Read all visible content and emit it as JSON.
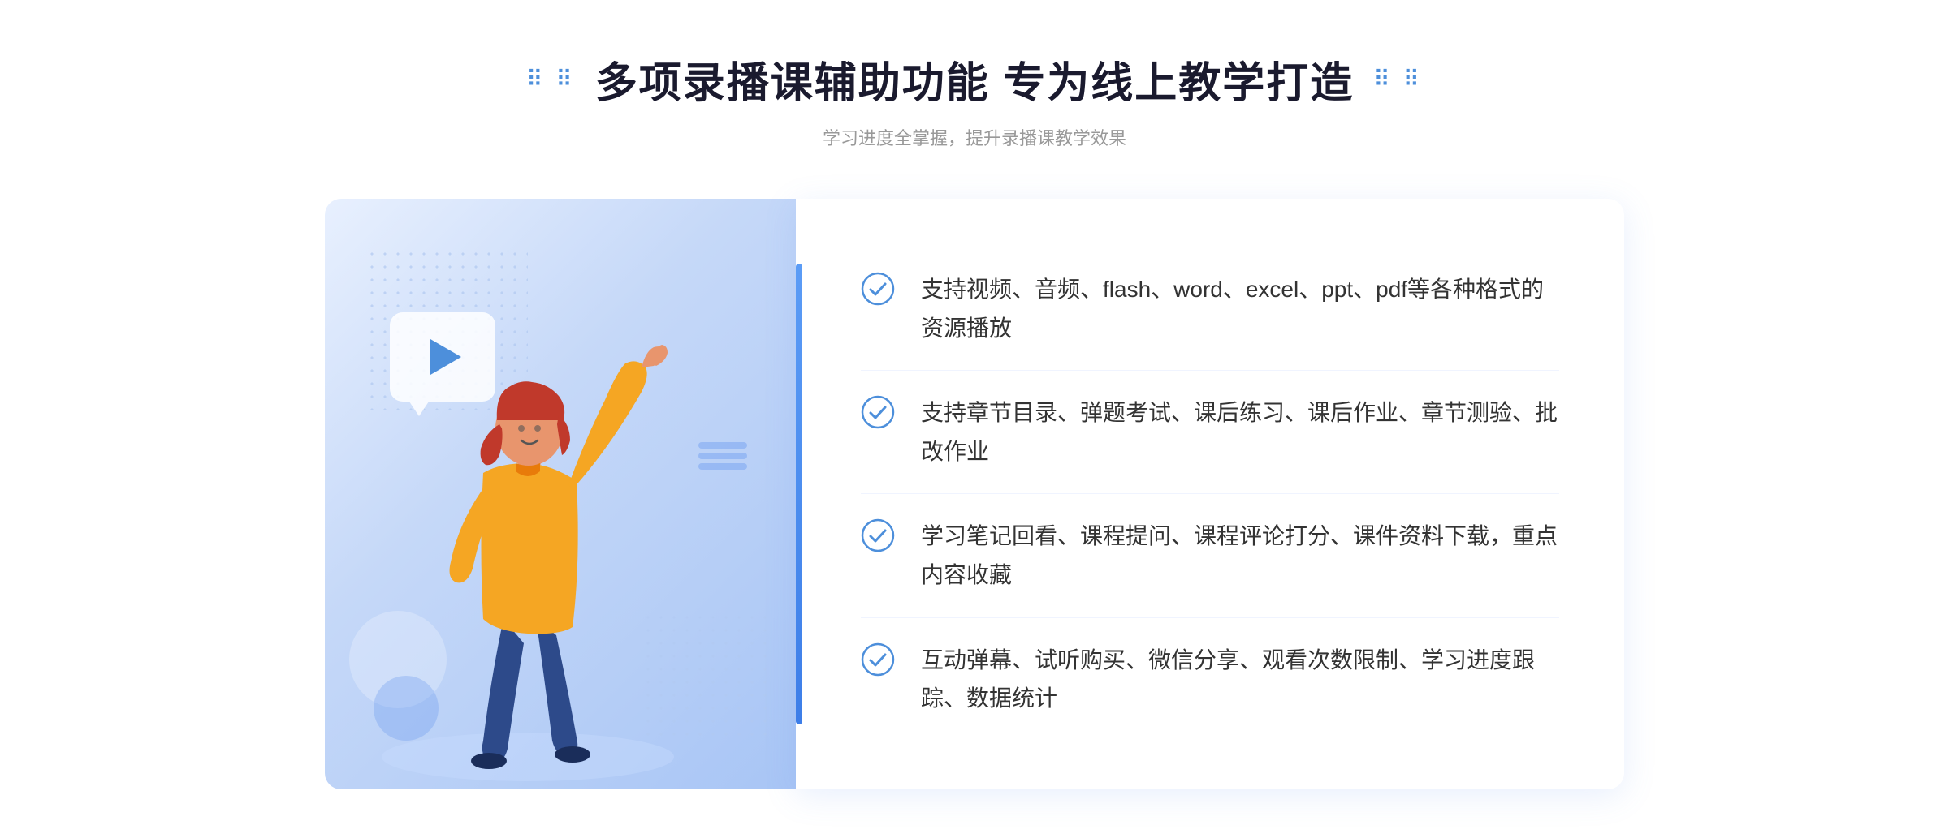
{
  "header": {
    "title": "多项录播课辅助功能 专为线上教学打造",
    "subtitle": "学习进度全掌握，提升录播课教学效果",
    "dots_left": "⠿",
    "dots_right": "⠿"
  },
  "features": [
    {
      "id": 1,
      "text": "支持视频、音频、flash、word、excel、ppt、pdf等各种格式的资源播放"
    },
    {
      "id": 2,
      "text": "支持章节目录、弹题考试、课后练习、课后作业、章节测验、批改作业"
    },
    {
      "id": 3,
      "text": "学习笔记回看、课程提问、课程评论打分、课件资料下载，重点内容收藏"
    },
    {
      "id": 4,
      "text": "互动弹幕、试听购买、微信分享、观看次数限制、学习进度跟踪、数据统计"
    }
  ],
  "colors": {
    "accent": "#3d7ee8",
    "accent_light": "#5b9cf6",
    "text_dark": "#1a1a2e",
    "text_gray": "#999",
    "text_body": "#333"
  },
  "icons": {
    "check": "check-circle",
    "play": "play-triangle",
    "left_arrows": "«",
    "dots": "⋮⋮"
  }
}
